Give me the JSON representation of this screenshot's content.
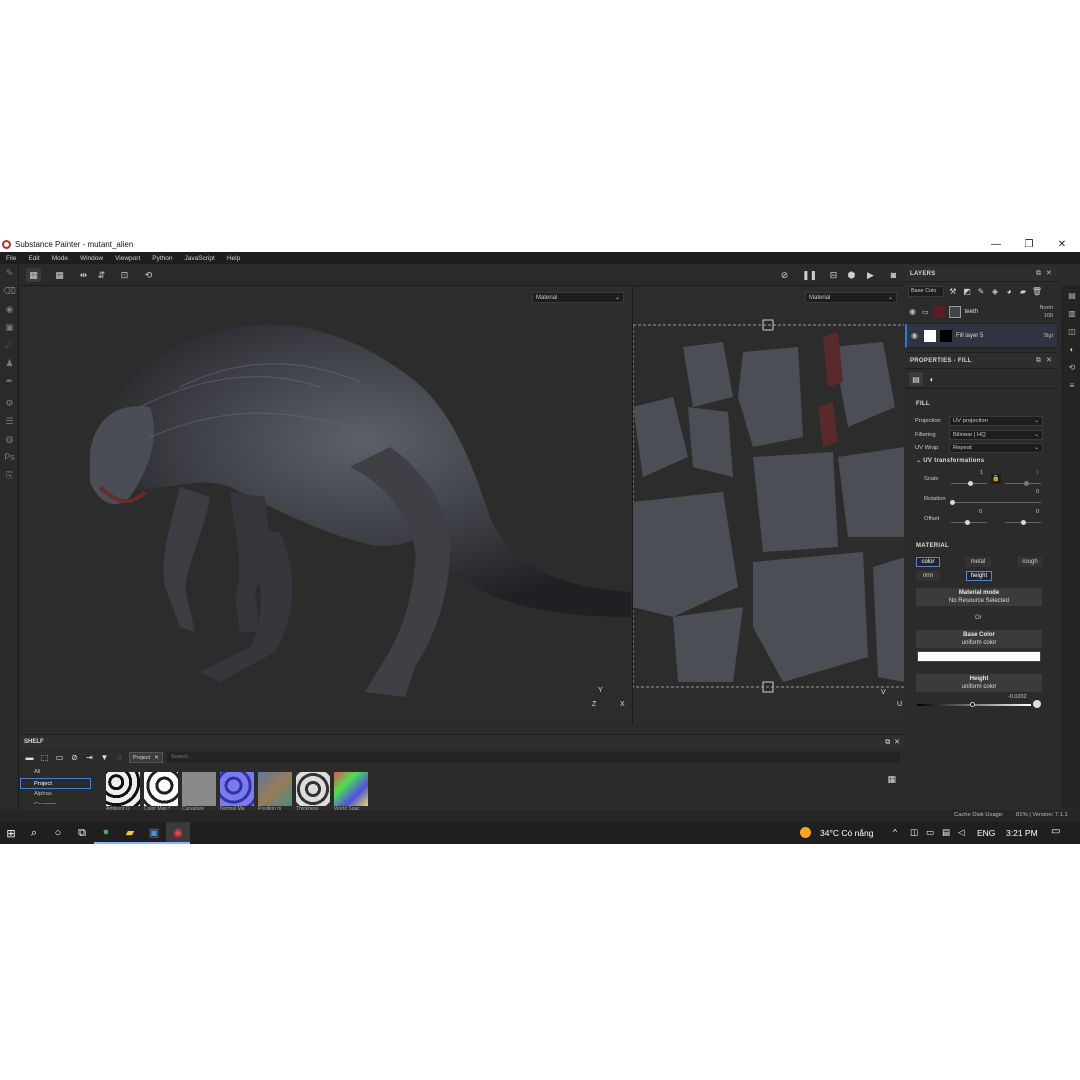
{
  "window": {
    "title": "Substance Painter - mutant_alien",
    "minimize": "—",
    "maximize": "❐",
    "close": "✕"
  },
  "menu": [
    "File",
    "Edit",
    "Mode",
    "Window",
    "Viewport",
    "Python",
    "JavaScript",
    "Help"
  ],
  "viewport": {
    "left_material": "Material",
    "right_material": "Material",
    "axis_3d_y": "Y",
    "axis_3d_z": "Z",
    "axis_3d_x": "X",
    "axis_2d_v": "V",
    "axis_2d_u": "U"
  },
  "layers": {
    "title": "LAYERS",
    "channel_dropdown": "Base Colo",
    "rows": [
      {
        "name": "teeth",
        "blend": "Norm",
        "opacity": "100"
      },
      {
        "name": "Fill layer 5",
        "blend": "Slgt"
      }
    ]
  },
  "properties": {
    "title": "PROPERTIES - FILL",
    "fill_section": "FILL",
    "projection_label": "Projection",
    "projection_value": "UV projection",
    "filtering_label": "Filtering",
    "filtering_value": "Bilinear | HQ",
    "uvwrap_label": "UV Wrap",
    "uvwrap_value": "Repeat",
    "uv_transform_title": "UV transformations",
    "scale_label": "Scale",
    "scale_value_1": "1",
    "scale_value_2": "1",
    "rotation_label": "Rotation",
    "rotation_value": "0",
    "offset_label": "Offset",
    "offset_value_1": "0",
    "offset_value_2": "0",
    "material_section": "MATERIAL",
    "channels": [
      "color",
      "metal",
      "rough",
      "nrm",
      "height"
    ],
    "material_mode_title": "Material mode",
    "material_mode_sub": "No Resource Selected",
    "or_text": "Or",
    "base_color_title": "Base Color",
    "base_color_sub": "uniform color",
    "base_color_swatch": "#ffffff",
    "height_title": "Height",
    "height_sub": "uniform color",
    "height_value": "-0.0202"
  },
  "shelf": {
    "title": "SHELF",
    "filter_chip": "Project",
    "search_placeholder": "Search...",
    "categories": [
      "All",
      "Project",
      "Alphas",
      "Grunges"
    ],
    "items": [
      "Ambient O",
      "Color Map f",
      "Curvature",
      "Normal Ma",
      "Position m",
      "Thickness",
      "World Spac"
    ]
  },
  "status": {
    "cache": "Cache Disk Usage:",
    "cache_value": "81% | Version: 7.1.1"
  },
  "taskbar": {
    "weather": "34°C  Có nắng",
    "language": "ENG",
    "time": "3:21 PM"
  },
  "colors": {
    "accent": "#3a73c9",
    "panel": "#2b2b2b",
    "viewport": "#2c2c2c",
    "appicon": "#c02a2a"
  }
}
